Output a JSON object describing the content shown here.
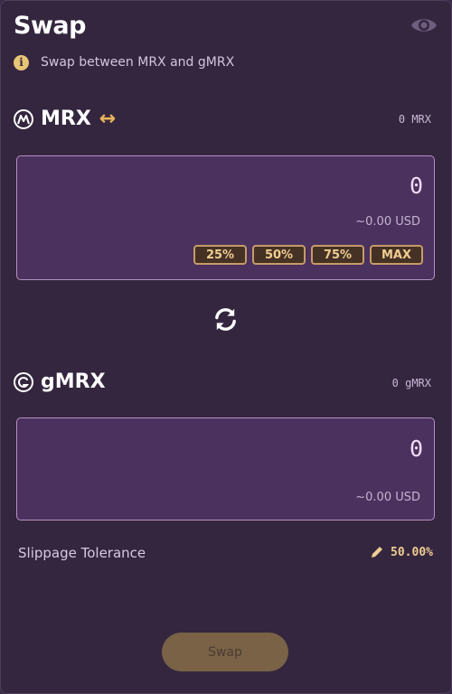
{
  "header": {
    "title": "Swap",
    "visibility_icon": "eye-icon"
  },
  "info": {
    "icon": "info-icon",
    "text": "Swap between MRX and gMRX"
  },
  "from": {
    "token": "MRX",
    "icon": "mrx-logo-icon",
    "direction_icon": "left-right-arrow-icon",
    "balance": "0 MRX",
    "amount": "0",
    "usd": "~0.00 USD",
    "quick_buttons": [
      "25%",
      "50%",
      "75%",
      "MAX"
    ]
  },
  "switch": {
    "icon": "refresh-icon"
  },
  "to": {
    "token": "gMRX",
    "icon": "gmrx-logo-icon",
    "balance": "0 gMRX",
    "amount": "0",
    "usd": "~0.00 USD"
  },
  "slippage": {
    "label": "Slippage Tolerance",
    "value": "50.00%",
    "edit_icon": "pencil-icon"
  },
  "action": {
    "swap_label": "Swap"
  },
  "colors": {
    "background": "#35263f",
    "input_bg": "#4a315e",
    "accent": "#f0cd91",
    "button": "#796246"
  }
}
